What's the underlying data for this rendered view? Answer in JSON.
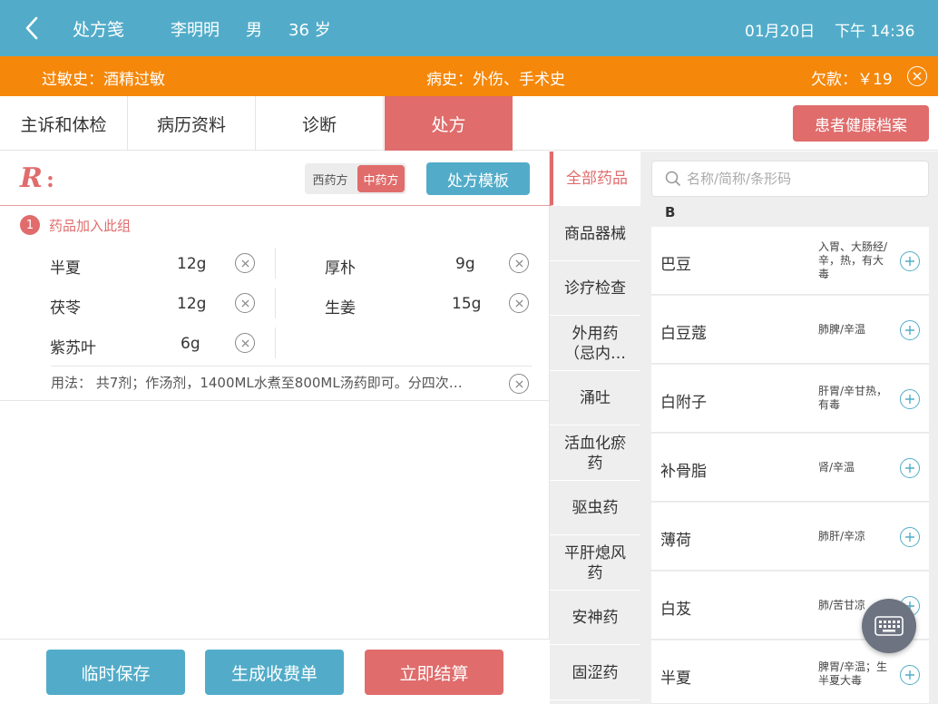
{
  "header": {
    "title": "处方笺",
    "patient_name": "李明明",
    "gender": "男",
    "age": "36 岁",
    "date": "01月20日",
    "time": "下午 14:36"
  },
  "infobar": {
    "allergy": "过敏史：酒精过敏",
    "history": "病史：外伤、手术史",
    "debt": "欠款：￥19"
  },
  "tabs": [
    {
      "label": "主诉和体检"
    },
    {
      "label": "病历资料"
    },
    {
      "label": "诊断"
    },
    {
      "label": "处方"
    }
  ],
  "health_button": "患者健康档案",
  "rx": {
    "logo": "R",
    "colon": ":",
    "seg_western": "西药方",
    "seg_chinese": "中药方",
    "template_button": "处方模板"
  },
  "group": {
    "number": "1",
    "label": "药品加入此组"
  },
  "herbs": [
    {
      "name": "半夏",
      "qty": "12g"
    },
    {
      "name": "厚朴",
      "qty": "9g"
    },
    {
      "name": "茯苓",
      "qty": "12g"
    },
    {
      "name": "生姜",
      "qty": "15g"
    },
    {
      "name": "紫苏叶",
      "qty": "6g"
    }
  ],
  "usage": "用法：  共7剂；作汤剂，1400ML水煮至800ML汤药即可。分四次…",
  "bottom": {
    "save": "临时保存",
    "bill": "生成收费单",
    "settle": "立即结算"
  },
  "categories": [
    {
      "label": "全部药品"
    },
    {
      "label": "商品器械"
    },
    {
      "label": "诊疗检查"
    },
    {
      "label": "外用药（忌内…"
    },
    {
      "label": "涌吐"
    },
    {
      "label": "活血化瘀药"
    },
    {
      "label": "驱虫药"
    },
    {
      "label": "平肝熄风药"
    },
    {
      "label": "安神药"
    },
    {
      "label": "固涩药"
    }
  ],
  "search": {
    "placeholder": "名称/简称/条形码"
  },
  "letter": "B",
  "drugs": [
    {
      "name": "巴豆",
      "prop": "入胃、大肠经/辛，热，有大毒"
    },
    {
      "name": "白豆蔻",
      "prop": "肺脾/辛温"
    },
    {
      "name": "白附子",
      "prop": "肝胃/辛甘热，有毒"
    },
    {
      "name": "补骨脂",
      "prop": "肾/辛温"
    },
    {
      "name": "薄荷",
      "prop": "肺肝/辛凉"
    },
    {
      "name": "白芨",
      "prop": "肺/苦甘凉"
    },
    {
      "name": "半夏",
      "prop": "脾胃/辛温；生半夏大毒"
    }
  ],
  "colors": {
    "primary_blue": "#52acc9",
    "accent_red": "#e06c6c",
    "warning_orange": "#f5870a"
  }
}
